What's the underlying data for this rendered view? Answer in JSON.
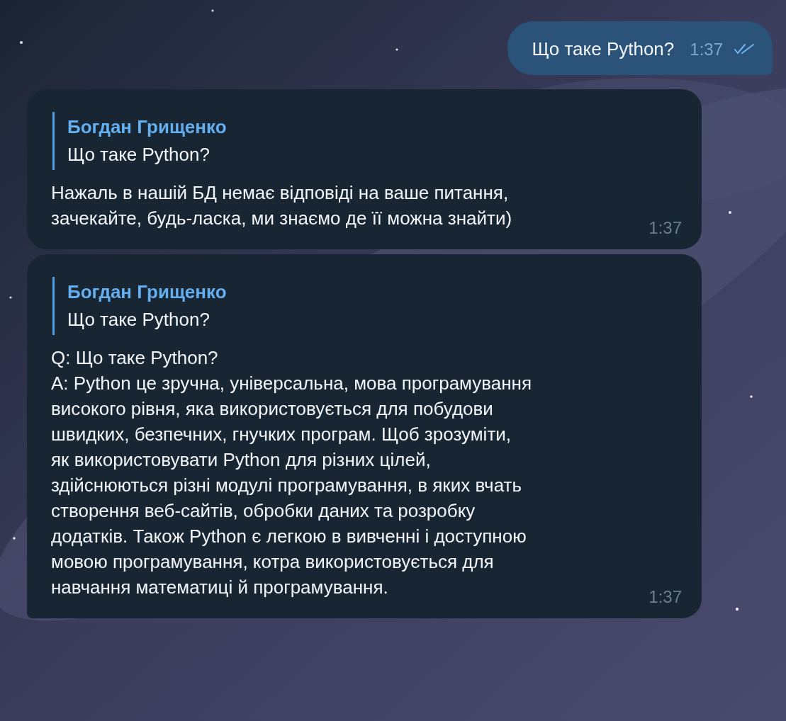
{
  "messages": [
    {
      "kind": "outgoing",
      "text": "Що таке Python?",
      "time": "1:37",
      "read": true
    },
    {
      "kind": "incoming",
      "reply": {
        "author": "Богдан Грищенко",
        "text": "Що таке Python?"
      },
      "text": "Нажаль в нашій БД немає відповіді на ваше питання,\nзачекайте, будь-ласка, ми знаємо де її можна знайти)",
      "time": "1:37"
    },
    {
      "kind": "incoming",
      "reply": {
        "author": "Богдан Грищенко",
        "text": "Що таке Python?"
      },
      "text": "Q: Що таке Python?\nA: Python це зручна, універсальна, мова програмування\nвисокого рівня, яка використовується для побудови\nшвидких, безпечних, гнучких програм. Щоб зрозуміти,\nяк використовувати Python для різних цілей,\nздійснюються різні модулі програмування, в яких вчать\nстворення веб-сайтів, обробки даних та розробку\nдодатків. Також Python є легкою в вивченні і доступною\nмовою програмування, котра використовується для\nнавчання математиці й програмування.",
      "time": "1:37"
    }
  ]
}
